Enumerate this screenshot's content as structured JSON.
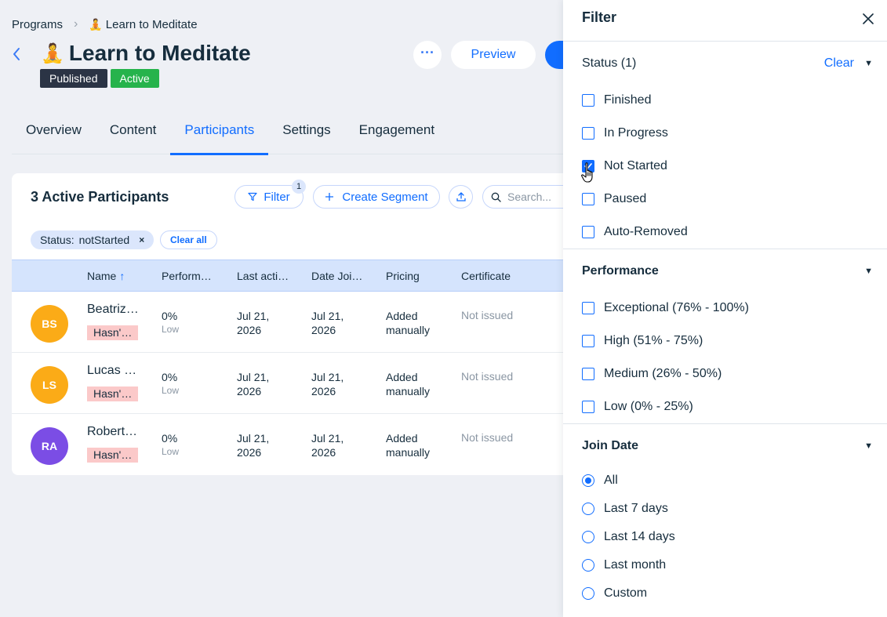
{
  "breadcrumb": {
    "root": "Programs",
    "current_emoji": "🧘",
    "current": "Learn to Meditate"
  },
  "header": {
    "title_emoji": "🧘",
    "title": "Learn to Meditate",
    "badges": {
      "published": "Published",
      "active": "Active"
    },
    "more_label": "···",
    "preview_label": "Preview"
  },
  "tabs": [
    {
      "label": "Overview"
    },
    {
      "label": "Content"
    },
    {
      "label": "Participants"
    },
    {
      "label": "Settings"
    },
    {
      "label": "Engagement"
    }
  ],
  "participants": {
    "title": "3 Active Participants",
    "filter_label": "Filter",
    "filter_count": "1",
    "segment_label": "Create Segment",
    "search_placeholder": "Search...",
    "chip": {
      "key": "Status:",
      "value": "notStarted",
      "remove": "×"
    },
    "clear_all": "Clear all",
    "columns": {
      "name": "Name",
      "sort_arrow": "↑",
      "performance": "Perform…",
      "last_activity": "Last acti…",
      "date_joined": "Date Joi…",
      "pricing": "Pricing",
      "certificate": "Certificate"
    },
    "rows": [
      {
        "initials": "BS",
        "avatar_color": "#fbab17",
        "name": "Beatriz…",
        "status": "Hasn'…",
        "perf": "0%",
        "perf_sub": "Low",
        "last_l1": "Jul 21,",
        "last_l2": "2026",
        "joined_l1": "Jul 21,",
        "joined_l2": "2026",
        "pricing_l1": "Added",
        "pricing_l2": "manually",
        "certificate": "Not issued"
      },
      {
        "initials": "LS",
        "avatar_color": "#fbab17",
        "name": "Lucas …",
        "status": "Hasn'…",
        "perf": "0%",
        "perf_sub": "Low",
        "last_l1": "Jul 21,",
        "last_l2": "2026",
        "joined_l1": "Jul 21,",
        "joined_l2": "2026",
        "pricing_l1": "Added",
        "pricing_l2": "manually",
        "certificate": "Not issued"
      },
      {
        "initials": "RA",
        "avatar_color": "#7b4de5",
        "name": "Robert…",
        "status": "Hasn'…",
        "perf": "0%",
        "perf_sub": "Low",
        "last_l1": "Jul 21,",
        "last_l2": "2026",
        "joined_l1": "Jul 21,",
        "joined_l2": "2026",
        "pricing_l1": "Added",
        "pricing_l2": "manually",
        "certificate": "Not issued"
      }
    ]
  },
  "filter_panel": {
    "title": "Filter",
    "status": {
      "title": "Status (1)",
      "clear": "Clear",
      "options": [
        {
          "label": "Finished",
          "checked": false
        },
        {
          "label": "In Progress",
          "checked": false
        },
        {
          "label": "Not Started",
          "checked": true
        },
        {
          "label": "Paused",
          "checked": false
        },
        {
          "label": "Auto-Removed",
          "checked": false
        }
      ]
    },
    "performance": {
      "title": "Performance",
      "options": [
        {
          "label": "Exceptional (76% - 100%)",
          "checked": false
        },
        {
          "label": "High (51% - 75%)",
          "checked": false
        },
        {
          "label": "Medium (26% - 50%)",
          "checked": false
        },
        {
          "label": "Low (0% - 25%)",
          "checked": false
        }
      ]
    },
    "join_date": {
      "title": "Join Date",
      "selected": "All",
      "options": [
        {
          "label": "All"
        },
        {
          "label": "Last 7 days"
        },
        {
          "label": "Last 14 days"
        },
        {
          "label": "Last month"
        },
        {
          "label": "Custom"
        }
      ]
    }
  },
  "colors": {
    "accent": "#116dff",
    "published_badge": "#2b3445",
    "active_badge": "#26b34c",
    "status_tag": "#fbc9c9",
    "table_header": "#d5e4fd"
  }
}
